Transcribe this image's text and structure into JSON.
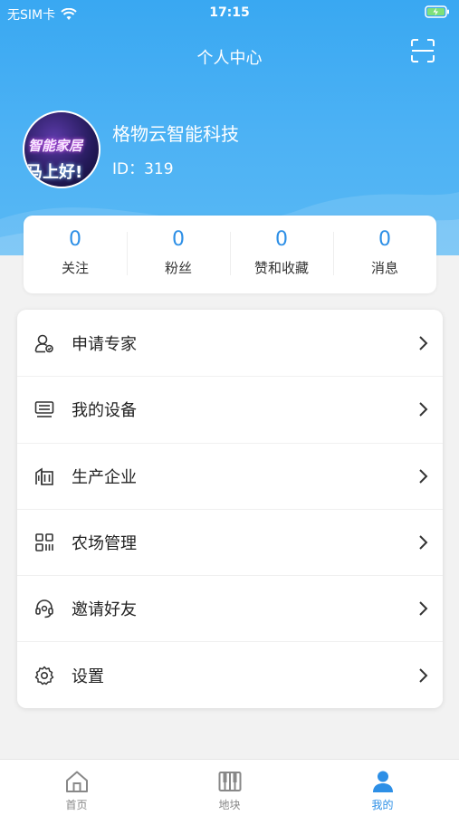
{
  "status_bar": {
    "carrier": "无SIM卡",
    "time": "17:15",
    "wifi_icon": "wifi-icon",
    "battery_icon": "battery-charging-icon"
  },
  "header": {
    "title": "个人中心",
    "scan_icon": "scan-icon"
  },
  "profile": {
    "avatar_text_1": "智能家居",
    "avatar_text_2": "马上好!",
    "name": "格物云智能科技",
    "id_text": "ID：319"
  },
  "stats": [
    {
      "value": "0",
      "label": "关注"
    },
    {
      "value": "0",
      "label": "粉丝"
    },
    {
      "value": "0",
      "label": "赞和收藏"
    },
    {
      "value": "0",
      "label": "消息"
    }
  ],
  "menu": [
    {
      "label": "申请专家",
      "icon": "expert-icon"
    },
    {
      "label": "我的设备",
      "icon": "device-icon"
    },
    {
      "label": "生产企业",
      "icon": "building-icon"
    },
    {
      "label": "农场管理",
      "icon": "grid-icon"
    },
    {
      "label": "邀请好友",
      "icon": "headset-icon"
    },
    {
      "label": "设置",
      "icon": "gear-icon"
    }
  ],
  "tabs": [
    {
      "label": "首页",
      "icon": "home-icon",
      "active": false
    },
    {
      "label": "地块",
      "icon": "field-icon",
      "active": false
    },
    {
      "label": "我的",
      "icon": "user-icon",
      "active": true
    }
  ],
  "colors": {
    "accent": "#2d8fe6",
    "header_gradient_top": "#39a8f2",
    "header_gradient_bottom": "#58b8f4"
  }
}
